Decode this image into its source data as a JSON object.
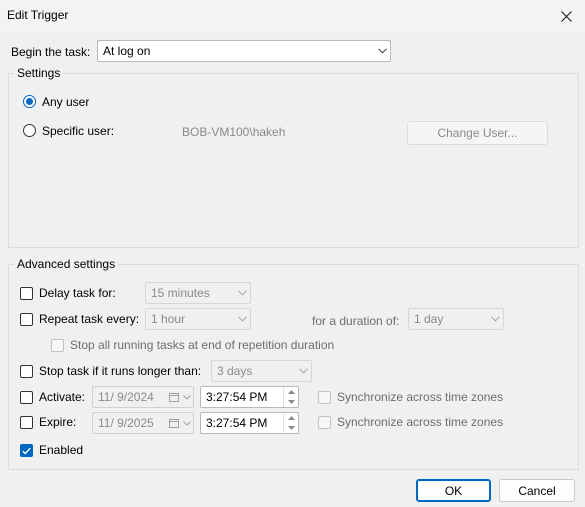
{
  "window": {
    "title": "Edit Trigger"
  },
  "begin": {
    "label": "Begin the task:",
    "value": "At log on"
  },
  "settings": {
    "legend": "Settings",
    "any_user": "Any user",
    "specific_user": "Specific user:",
    "user_name": "BOB-VM100\\hakeh",
    "change_user": "Change User..."
  },
  "advanced": {
    "legend": "Advanced settings",
    "delay_label": "Delay task for:",
    "delay_value": "15 minutes",
    "repeat_label": "Repeat task every:",
    "repeat_value": "1 hour",
    "duration_label": "for a duration of:",
    "duration_value": "1 day",
    "stop_all_label": "Stop all running tasks at end of repetition duration",
    "stop_if_label": "Stop task if it runs longer than:",
    "stop_if_value": "3 days",
    "activate_label": "Activate:",
    "activate_date": "11/ 9/2024",
    "activate_time": "3:27:54 PM",
    "activate_sync": "Synchronize across time zones",
    "expire_label": "Expire:",
    "expire_date": "11/ 9/2025",
    "expire_time": "3:27:54 PM",
    "expire_sync": "Synchronize across time zones",
    "enabled_label": "Enabled"
  },
  "buttons": {
    "ok": "OK",
    "cancel": "Cancel"
  },
  "colors": {
    "accent": "#0067c0",
    "background": "#f0f0f0"
  }
}
